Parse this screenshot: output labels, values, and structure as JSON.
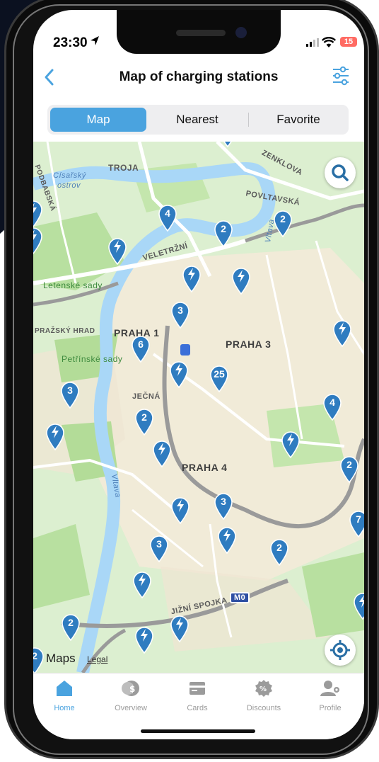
{
  "status": {
    "time": "23:30",
    "battery": "15"
  },
  "header": {
    "title": "Map of charging stations"
  },
  "segments": [
    {
      "label": "Map",
      "active": true
    },
    {
      "label": "Nearest",
      "active": false
    },
    {
      "label": "Favorite",
      "active": false
    }
  ],
  "map": {
    "labels": {
      "troja": "TROJA",
      "cisarsky": "Císařský",
      "ostrov": "ostrov",
      "podbaba": "PODBABSKÁ",
      "zenklova": "ZENKLOVA",
      "povltavska": "POVLTAVSKÁ",
      "veletrzni": "VELETRŽNÍ",
      "letenske": "Letenské sady",
      "prazsky_hrad": "PRAŽSKÝ HRAD",
      "praha1": "PRAHA 1",
      "praha3": "PRAHA 3",
      "praha4": "PRAHA 4",
      "petrinske": "Petřínské sady",
      "jecna": "JEČNÁ",
      "vltava1": "Vltava",
      "vltava2": "Vltava",
      "jizni_spojka": "JIŽNÍ SPOJKA",
      "m0": "M0"
    },
    "pins": [
      {
        "label": "4"
      },
      {
        "label": "2"
      },
      {
        "label": "2"
      },
      {
        "label": "3"
      },
      {
        "label": "6"
      },
      {
        "label": "25"
      },
      {
        "label": "3"
      },
      {
        "label": "4"
      },
      {
        "label": "2"
      },
      {
        "label": "2"
      },
      {
        "label": "3"
      },
      {
        "label": "3"
      },
      {
        "label": "2"
      },
      {
        "label": "2"
      },
      {
        "label": "7"
      },
      {
        "label": "2"
      }
    ],
    "attribution": "Maps",
    "legal": "Legal"
  },
  "tabs": [
    {
      "label": "Home",
      "icon": "home-icon",
      "active": true
    },
    {
      "label": "Overview",
      "icon": "overview-icon",
      "active": false
    },
    {
      "label": "Cards",
      "icon": "cards-icon",
      "active": false
    },
    {
      "label": "Discounts",
      "icon": "discounts-icon",
      "active": false
    },
    {
      "label": "Profile",
      "icon": "profile-icon",
      "active": false
    }
  ],
  "colors": {
    "accent": "#4aa3df",
    "pin": "#2f7cc0",
    "water": "#a9d7f7",
    "park": "#bfe3a5",
    "road": "#ffffff"
  }
}
